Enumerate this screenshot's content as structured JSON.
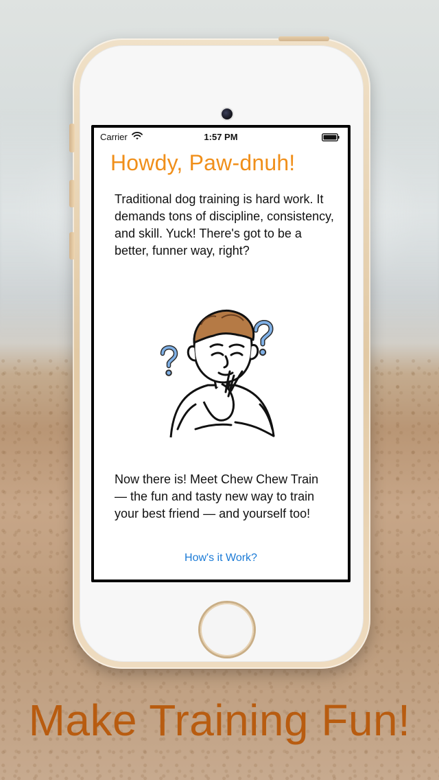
{
  "status_bar": {
    "carrier": "Carrier",
    "time": "1:57 PM"
  },
  "screen": {
    "title": "Howdy, Paw-dnuh!",
    "paragraph_1": "Traditional dog training is hard work. It demands tons of discipline, consistency, and skill. Yuck! There's got to be a better, funner way, right?",
    "paragraph_2": "Now there is! Meet Chew Chew Train — the fun and tasty new way to train your best friend — and yourself too!",
    "cta_label": "How's it Work?"
  },
  "caption": {
    "text": "Make Training Fun!"
  },
  "colors": {
    "title": "#f08f1a",
    "link": "#1a7ad6",
    "caption": "#b85c10"
  },
  "icons": {
    "wifi": "wifi-icon",
    "battery": "battery-icon",
    "illustration": "thinking-man-illustration"
  }
}
